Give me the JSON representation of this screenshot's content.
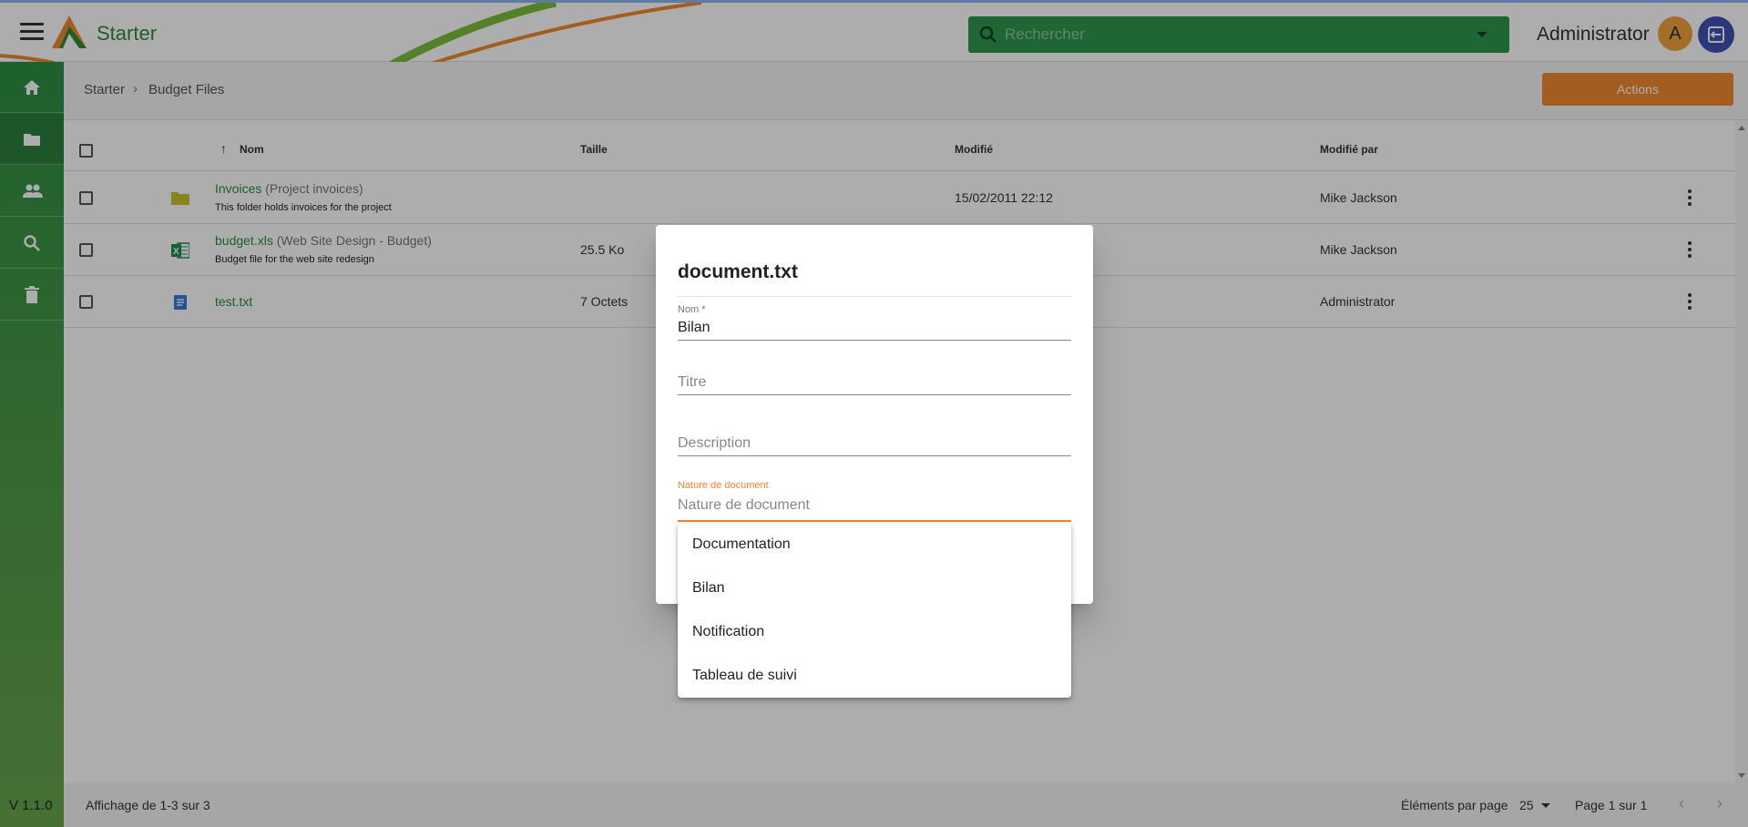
{
  "header": {
    "app_title": "Starter",
    "search_placeholder": "Rechercher",
    "user_name": "Administrator",
    "avatar_letter": "A"
  },
  "sidebar": {
    "items": [
      {
        "icon": "home-icon"
      },
      {
        "icon": "folder-icon",
        "active": true
      },
      {
        "icon": "people-icon"
      },
      {
        "icon": "search-icon"
      },
      {
        "icon": "trash-icon"
      }
    ],
    "version": "V 1.1.0"
  },
  "breadcrumb": {
    "root": "Starter",
    "separator": "›",
    "current": "Budget Files"
  },
  "toolbar": {
    "actions_label": "Actions"
  },
  "table": {
    "columns": {
      "name": "Nom",
      "size": "Taille",
      "modified": "Modifié",
      "modified_by": "Modifié par"
    },
    "rows": [
      {
        "name": "Invoices",
        "title": "(Project invoices)",
        "description": "This folder holds invoices for the project",
        "size": "",
        "modified": "15/02/2011 22:12",
        "modified_by": "Mike Jackson",
        "icon": "folder-icon"
      },
      {
        "name": "budget.xls",
        "title": "(Web Site Design - Budget)",
        "description": "Budget file for the web site redesign",
        "size": "25.5 Ko",
        "modified": "",
        "modified_by": "Mike Jackson",
        "icon": "excel-icon"
      },
      {
        "name": "test.txt",
        "title": "",
        "description": "",
        "size": "7 Octets",
        "modified": "",
        "modified_by": "Administrator",
        "icon": "document-icon"
      }
    ]
  },
  "footer": {
    "count": "Affichage de 1-3 sur 3",
    "per_page_label": "Éléments par page",
    "per_page_value": "25",
    "page": "Page 1 sur 1"
  },
  "dialog": {
    "title": "document.txt",
    "name_label": "Nom *",
    "name_value": "Bilan",
    "title_placeholder": "Titre",
    "description_placeholder": "Description",
    "nature_label": "Nature de document",
    "nature_placeholder": "Nature de document",
    "options": [
      "Documentation",
      "Bilan",
      "Notification",
      "Tableau de suivi"
    ]
  },
  "colors": {
    "brand_green": "#2e8b3a",
    "search_green": "#2e9550",
    "accent_orange": "#f08a2d",
    "logout_blue": "#3f51b5"
  }
}
